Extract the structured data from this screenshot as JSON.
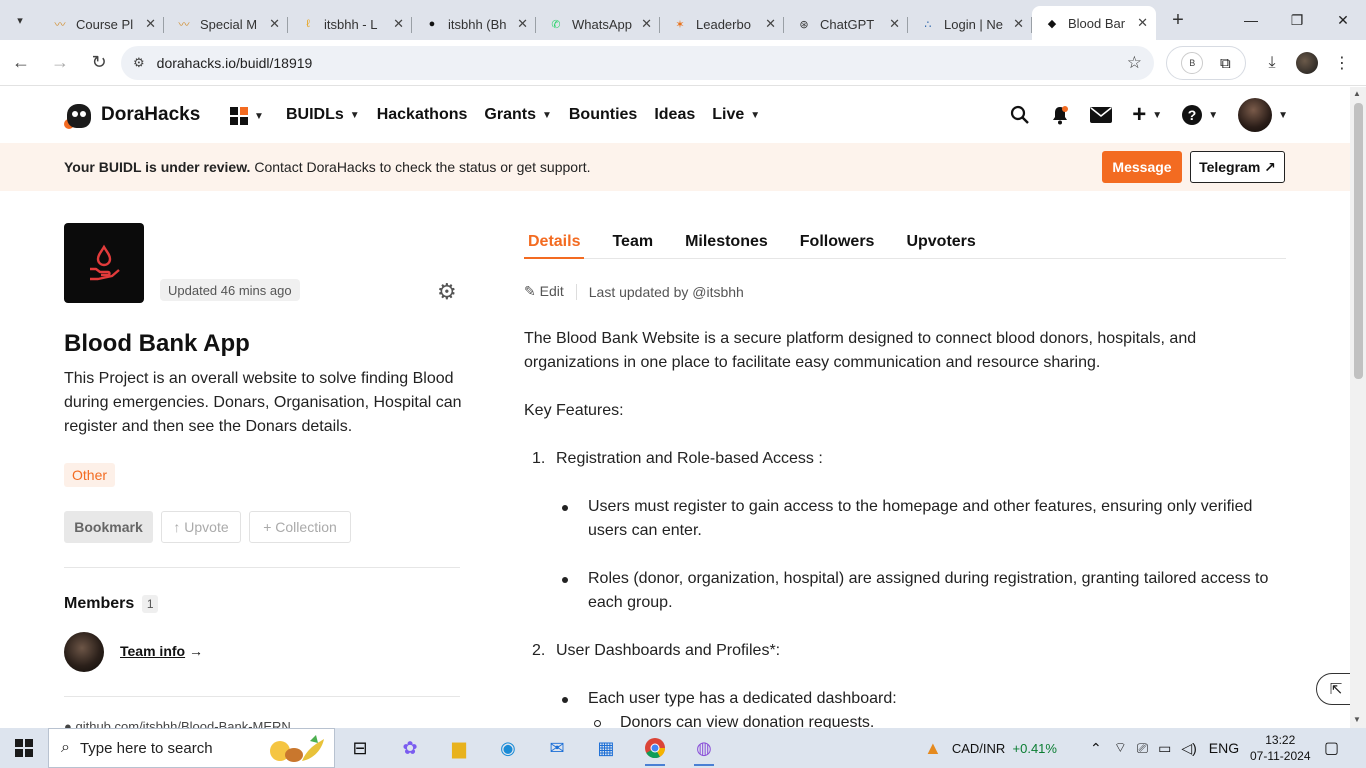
{
  "browser": {
    "tabs": [
      {
        "title": "Course Pl",
        "icon": "course-icon"
      },
      {
        "title": "Special M",
        "icon": "course-icon"
      },
      {
        "title": "itsbhh - L",
        "icon": "leetcode-icon"
      },
      {
        "title": "itsbhh (Bh",
        "icon": "github-icon"
      },
      {
        "title": "WhatsApp",
        "icon": "whatsapp-icon"
      },
      {
        "title": "Leaderbo",
        "icon": "leaderboard-icon"
      },
      {
        "title": "ChatGPT",
        "icon": "chatgpt-icon"
      },
      {
        "title": "Login | Ne",
        "icon": "cisco-icon"
      },
      {
        "title": "Blood Bar",
        "icon": "dorahacks-icon",
        "active": true
      }
    ],
    "url": "dorahacks.io/buidl/18919",
    "extension_letter": "B"
  },
  "site": {
    "brand": "DoraHacks",
    "nav": [
      "BUIDLs",
      "Hackathons",
      "Grants",
      "Bounties",
      "Ideas",
      "Live"
    ],
    "nav_with_dropdown": [
      "BUIDLs",
      "Grants",
      "Live"
    ],
    "accent_color": "#f36b21"
  },
  "banner": {
    "bold": "Your BUIDL is under review.",
    "text": " Contact DoraHacks to check the status or get support.",
    "message_btn": "Message",
    "telegram_btn": "Telegram ↗"
  },
  "project": {
    "updated": "Updated 46 mins ago",
    "title": "Blood Bank App",
    "description": "This Project is an overall website to solve finding Blood during emergencies. Donars, Organisation, Hospital can register and then see the Donars details.",
    "tag": "Other",
    "bookmark": "Bookmark",
    "upvote": "↑ Upvote",
    "collection": "+ Collection",
    "members_heading": "Members",
    "members_count": "1",
    "team_info": "Team info",
    "team_info_arrow": "→",
    "repo": "github.com/itsbhh/Blood-Bank-MERN"
  },
  "details": {
    "tabs": [
      "Details",
      "Team",
      "Milestones",
      "Followers",
      "Upvoters"
    ],
    "edit": "Edit",
    "last_updated": "Last updated by @itsbhh",
    "intro": "The Blood Bank Website is a secure platform designed to connect blood donors, hospitals, and organizations in one place to facilitate easy communication and resource sharing.",
    "key_features": "Key Features:",
    "item1_num": "1.",
    "item1": "Registration and Role-based Access :",
    "item1_b1": "Users must register to gain access to the homepage and other features, ensuring only verified users can enter.",
    "item1_b2": "Roles (donor, organization, hospital) are assigned during registration, granting tailored access to each group.",
    "item2_num": "2.",
    "item2": "User Dashboards and Profiles*:",
    "item2_b1": "Each user type has a dedicated dashboard:",
    "item2_s1": "Donors can view donation requests."
  },
  "taskbar": {
    "search_placeholder": "Type here to search",
    "currency": "CAD/INR",
    "currency_change": "+0.41%",
    "lang": "ENG",
    "time": "13:22",
    "date": "07-11-2024"
  }
}
